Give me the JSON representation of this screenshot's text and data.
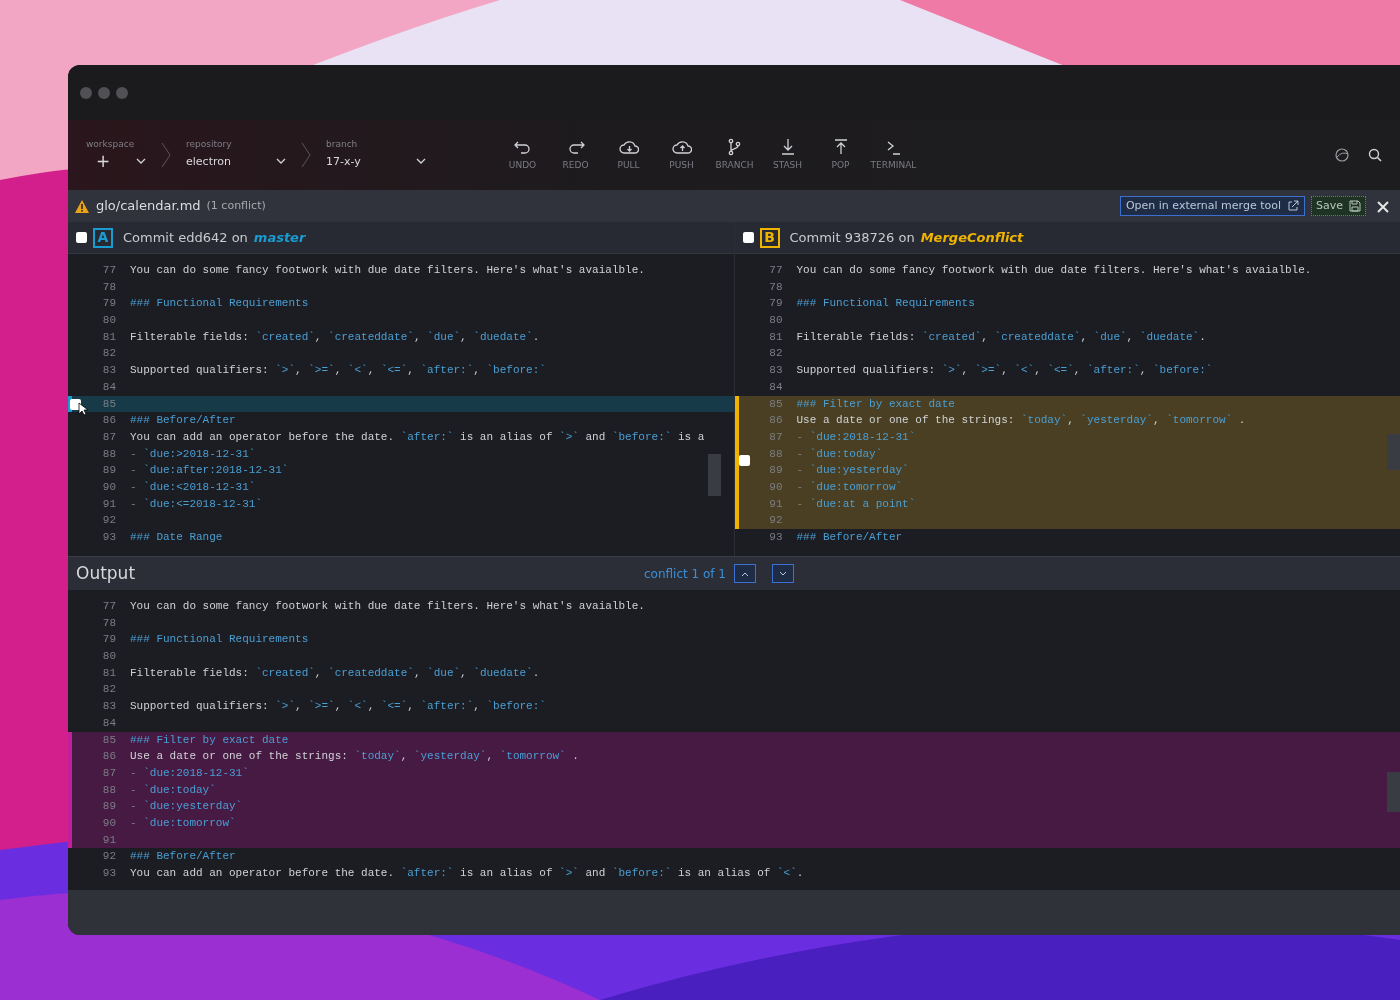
{
  "toolbar": {
    "selectors": [
      {
        "label": "workspace",
        "value": "+"
      },
      {
        "label": "repository",
        "value": "electron"
      },
      {
        "label": "branch",
        "value": "17-x-y"
      }
    ],
    "actions": [
      {
        "label": "UNDO",
        "kind": "undo"
      },
      {
        "label": "REDO",
        "kind": "redo"
      },
      {
        "label": "PULL",
        "kind": "pull"
      },
      {
        "label": "PUSH",
        "kind": "push"
      },
      {
        "label": "BRANCH",
        "kind": "branch"
      },
      {
        "label": "STASH",
        "kind": "stash"
      },
      {
        "label": "POP",
        "kind": "pop"
      },
      {
        "label": "TERMINAL",
        "kind": "terminal"
      }
    ]
  },
  "file_bar": {
    "path": "glo/calendar.md",
    "conflicts": "(1 conflict)",
    "buttons": [
      {
        "label": "Open in external merge tool",
        "kind": "external"
      },
      {
        "label": "Save",
        "kind": "save"
      }
    ]
  },
  "panes": [
    {
      "kind": "ours",
      "letter": "A",
      "color": "#1a9bd1",
      "commit": "Commit edd642 on",
      "branch": "master",
      "checked": false,
      "hunk_checked": false,
      "lines": [
        {
          "n": "77",
          "kind": "text",
          "highlighted": false,
          "text": "You can do some fancy footwork with due date filters. Here's what's avaialble."
        },
        {
          "n": "78",
          "kind": "blank",
          "highlighted": false
        },
        {
          "n": "79",
          "kind": "heading",
          "highlighted": false,
          "text": "### Functional Requirements"
        },
        {
          "n": "80",
          "kind": "blank",
          "highlighted": false
        },
        {
          "n": "81",
          "kind": "text",
          "highlighted": false,
          "text": "Filterable fields: `created`, `createddate`, `due`, `duedate`."
        },
        {
          "n": "82",
          "kind": "blank",
          "highlighted": false
        },
        {
          "n": "83",
          "kind": "text",
          "highlighted": false,
          "text": "Supported qualifiers: `>`, `>=`, `<`, `<=`, `after:`, `before:`"
        },
        {
          "n": "84",
          "kind": "blank",
          "highlighted": false
        },
        {
          "n": "85",
          "kind": "blank",
          "highlighted": true
        },
        {
          "n": "86",
          "kind": "heading",
          "highlighted": false,
          "text": "### Before/After"
        },
        {
          "n": "87",
          "kind": "text",
          "highlighted": false,
          "text": "You can add an operator before the date. `after:` is an alias of `>` and `before:` is a"
        },
        {
          "n": "88",
          "kind": "list",
          "highlighted": false,
          "text": "- `due:>2018-12-31`"
        },
        {
          "n": "89",
          "kind": "list",
          "highlighted": false,
          "text": "- `due:after:2018-12-31`"
        },
        {
          "n": "90",
          "kind": "list",
          "highlighted": false,
          "text": "- `due:<2018-12-31`"
        },
        {
          "n": "91",
          "kind": "list",
          "highlighted": false,
          "text": "- `due:<=2018-12-31`"
        },
        {
          "n": "92",
          "kind": "blank",
          "highlighted": false
        },
        {
          "n": "93",
          "kind": "heading",
          "highlighted": false,
          "text": "### Date Range"
        }
      ]
    },
    {
      "kind": "theirs",
      "letter": "B",
      "color": "#f0b400",
      "commit": "Commit 938726 on",
      "branch": "MergeConflict",
      "checked": false,
      "hunk_checked": false,
      "lines": [
        {
          "n": "77",
          "kind": "text",
          "highlighted": false,
          "text": "You can do some fancy footwork with due date filters. Here's what's avaialble."
        },
        {
          "n": "78",
          "kind": "blank",
          "highlighted": false
        },
        {
          "n": "79",
          "kind": "heading",
          "highlighted": false,
          "text": "### Functional Requirements"
        },
        {
          "n": "80",
          "kind": "blank",
          "highlighted": false
        },
        {
          "n": "81",
          "kind": "text",
          "highlighted": false,
          "text": "Filterable fields: `created`, `createddate`, `due`, `duedate`."
        },
        {
          "n": "82",
          "kind": "blank",
          "highlighted": false
        },
        {
          "n": "83",
          "kind": "text",
          "highlighted": false,
          "text": "Supported qualifiers: `>`, `>=`, `<`, `<=`, `after:`, `before:`"
        },
        {
          "n": "84",
          "kind": "blank",
          "highlighted": false
        },
        {
          "n": "85",
          "kind": "heading",
          "highlighted": true,
          "text": "### Filter by exact date"
        },
        {
          "n": "86",
          "kind": "text",
          "highlighted": true,
          "text": "Use a date or one of the strings: `today`, `yesterday`, `tomorrow` ."
        },
        {
          "n": "87",
          "kind": "list",
          "highlighted": true,
          "text": "- `due:2018-12-31`"
        },
        {
          "n": "88",
          "kind": "list",
          "highlighted": true,
          "text": "- `due:today`"
        },
        {
          "n": "89",
          "kind": "list",
          "highlighted": true,
          "text": "- `due:yesterday`"
        },
        {
          "n": "90",
          "kind": "list",
          "highlighted": true,
          "text": "- `due:tomorrow`"
        },
        {
          "n": "91",
          "kind": "list",
          "highlighted": true,
          "text": "- `due:at a point`"
        },
        {
          "n": "92",
          "kind": "blank",
          "highlighted": true
        },
        {
          "n": "93",
          "kind": "heading",
          "highlighted": false,
          "text": "### Before/After"
        }
      ]
    }
  ],
  "output": {
    "kind": "output",
    "title": "Output",
    "conflict_counter": "conflict 1 of 1",
    "lines": [
      {
        "n": "77",
        "kind": "text",
        "highlighted": false,
        "text": "You can do some fancy footwork with due date filters. Here's what's avaialble."
      },
      {
        "n": "78",
        "kind": "blank",
        "highlighted": false
      },
      {
        "n": "79",
        "kind": "heading",
        "highlighted": false,
        "text": "### Functional Requirements"
      },
      {
        "n": "80",
        "kind": "blank",
        "highlighted": false
      },
      {
        "n": "81",
        "kind": "text",
        "highlighted": false,
        "text": "Filterable fields: `created`, `createddate`, `due`, `duedate`."
      },
      {
        "n": "82",
        "kind": "blank",
        "highlighted": false
      },
      {
        "n": "83",
        "kind": "text",
        "highlighted": false,
        "text": "Supported qualifiers: `>`, `>=`, `<`, `<=`, `after:`, `before:`"
      },
      {
        "n": "84",
        "kind": "blank",
        "highlighted": false
      },
      {
        "n": "85",
        "kind": "heading",
        "highlighted": true,
        "text": "### Filter by exact date"
      },
      {
        "n": "86",
        "kind": "text",
        "highlighted": true,
        "text": "Use a date or one of the strings: `today`, `yesterday`, `tomorrow` ."
      },
      {
        "n": "87",
        "kind": "list",
        "highlighted": true,
        "text": "- `due:2018-12-31`"
      },
      {
        "n": "88",
        "kind": "list",
        "highlighted": true,
        "text": "- `due:today`"
      },
      {
        "n": "89",
        "kind": "list",
        "highlighted": true,
        "text": "- `due:yesterday`"
      },
      {
        "n": "90",
        "kind": "list",
        "highlighted": true,
        "text": "- `due:tomorrow`"
      },
      {
        "n": "91",
        "kind": "blank",
        "highlighted": true
      },
      {
        "n": "92",
        "kind": "heading",
        "highlighted": false,
        "text": "### Before/After"
      },
      {
        "n": "93",
        "kind": "text",
        "highlighted": false,
        "text": "You can add an operator before the date. `after:` is an alias of `>` and `before:` is an alias of `<`."
      }
    ]
  }
}
